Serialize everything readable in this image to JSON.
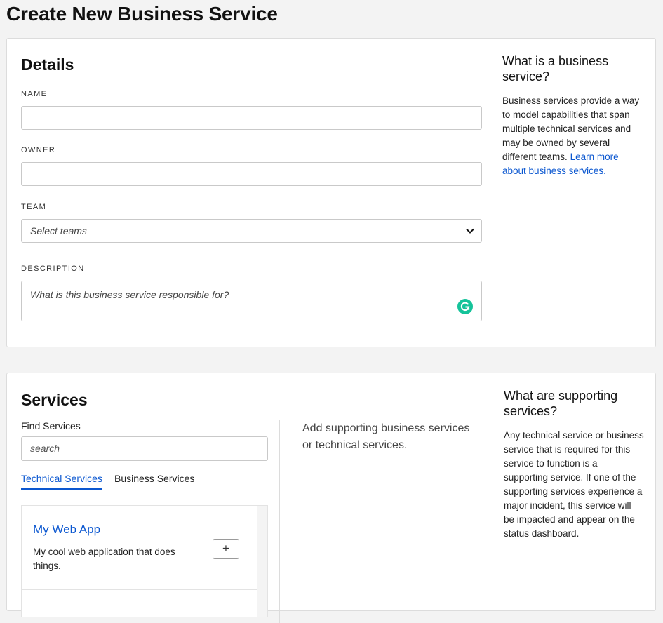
{
  "page_title": "Create New Business Service",
  "details": {
    "title": "Details",
    "name_label": "NAME",
    "name_value": "",
    "owner_label": "OWNER",
    "owner_value": "",
    "team_label": "TEAM",
    "team_placeholder": "Select teams",
    "description_label": "DESCRIPTION",
    "description_placeholder": "What is this business service responsible for?",
    "aside_title": "What is a business service?",
    "aside_body": "Business services provide a way to model capabilities that span multiple technical services and may be owned by several different teams.",
    "aside_link": "Learn more about business services."
  },
  "services": {
    "title": "Services",
    "find_label": "Find Services",
    "search_placeholder": "search",
    "tabs": [
      "Technical Services",
      "Business Services"
    ],
    "items": [
      {
        "title": "My Web App",
        "description": "My cool web application that does things.",
        "add_label": "+"
      }
    ],
    "empty_message": "Add supporting business services or technical services.",
    "aside_title": "What are supporting services?",
    "aside_body": "Any technical service or business service that is required for this service to function is a supporting service. If one of the supporting services experience a major incident, this service will be impacted and appear on the status dashboard."
  },
  "colors": {
    "accent": "#0b57d0",
    "grammarly": "#15c39a"
  },
  "icons": [
    "chevron-down-icon",
    "grammarly-icon",
    "plus-icon"
  ]
}
